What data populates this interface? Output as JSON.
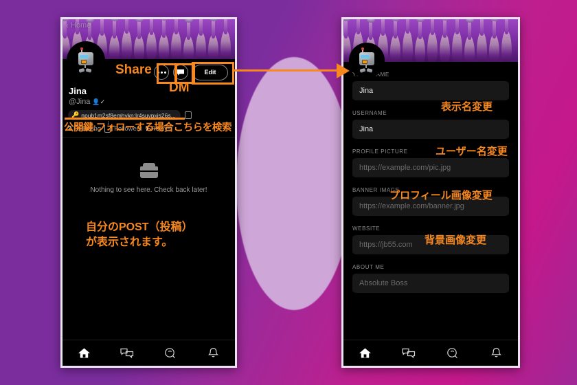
{
  "background": {
    "gradient_from": "#7b2d9e",
    "gradient_to": "#c4188b",
    "blob_color": "#cfa6d8"
  },
  "accent": {
    "annotation_orange": "#f6881f"
  },
  "left_phone": {
    "back_nav": {
      "label": "Home",
      "icon": "chevron-left-icon"
    },
    "banner": {
      "name": "ostrich-banner-image"
    },
    "avatar": {
      "name": "robot-avatar"
    },
    "actions": {
      "share_icon": "ellipsis-icon",
      "dm_icon": "message-bubble-icon",
      "edit_label": "Edit"
    },
    "display_name": "Jina",
    "handle": "@Jina",
    "verified_icon": "verified-user-icon",
    "npub": {
      "key_icon": "key-icon",
      "text": "npub1m2sf8emhykn:lr4suypxjs26s...",
      "copy_icon": "copy-icon"
    },
    "stats": {
      "following_count": "2",
      "following_label": "Following",
      "followers_icon": "download-icon",
      "followers_label": "Followers",
      "relays_count": "7",
      "relays_label": "Relays"
    },
    "feed": {
      "empty_icon": "inbox-tray-icon",
      "empty_text": "Nothing to see here. Check back later!"
    },
    "nav": [
      {
        "name": "home",
        "icon": "home-icon",
        "active": true
      },
      {
        "name": "messages",
        "icon": "chat-bubbles-icon",
        "active": false
      },
      {
        "name": "search",
        "icon": "search-globe-icon",
        "active": false
      },
      {
        "name": "notifications",
        "icon": "bell-icon",
        "active": false
      }
    ]
  },
  "right_phone": {
    "banner": {
      "name": "ostrich-banner-image"
    },
    "avatar": {
      "name": "robot-avatar"
    },
    "fields": [
      {
        "label": "YOUR NAME",
        "value": "Jina",
        "placeholder": "",
        "filled": true
      },
      {
        "label": "USERNAME",
        "value": "Jina",
        "placeholder": "",
        "filled": true
      },
      {
        "label": "PROFILE PICTURE",
        "value": "https://example.com/pic.jpg",
        "placeholder": "https://example.com/pic.jpg",
        "filled": false
      },
      {
        "label": "BANNER IMAGE",
        "value": "https://example.com/banner.jpg",
        "placeholder": "https://example.com/banner.jpg",
        "filled": false
      },
      {
        "label": "WEBSITE",
        "value": "https://jb55.com",
        "placeholder": "https://jb55.com",
        "filled": false
      },
      {
        "label": "ABOUT ME",
        "value": "Absolute Boss",
        "placeholder": "Absolute Boss",
        "filled": false
      }
    ],
    "nav": [
      {
        "name": "home",
        "icon": "home-icon",
        "active": true
      },
      {
        "name": "messages",
        "icon": "chat-bubbles-icon",
        "active": false
      },
      {
        "name": "search",
        "icon": "search-globe-icon",
        "active": false
      },
      {
        "name": "notifications",
        "icon": "bell-icon",
        "active": false
      }
    ]
  },
  "annotations": {
    "share": "Share",
    "dm": "DM",
    "public_key": "公開鍵:フォローする場合こちらを検索",
    "post_line1": "自分のPOST（投稿）",
    "post_line2": "が表示されます。",
    "display_name_change": "表示名変更",
    "username_change": "ユーザー名変更",
    "profile_picture_change": "プロフィール画像変更",
    "banner_image_change": "背景画像変更"
  }
}
